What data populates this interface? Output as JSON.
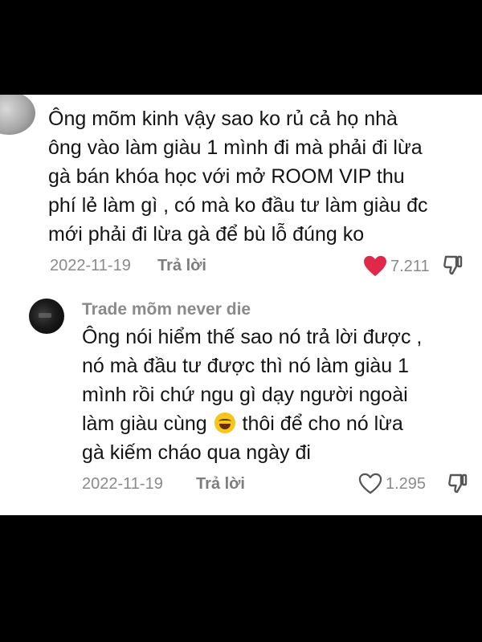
{
  "comment1": {
    "author_fragment": "",
    "text": "Ông mõm kinh vậy sao ko rủ cả họ nhà\nông vào làm giàu 1 mình đi mà phải đi lừa\ngà bán khóa học với mở ROOM VIP thu\nphí lẻ làm gì , có mà ko đầu tư làm giàu đc\nmới phải đi lừa gà để bù lỗ đúng ko",
    "date": "2022-11-19",
    "reply_label": "Trả lời",
    "likes": "7.211",
    "liked": true
  },
  "comment2": {
    "author": "Trade mõm never die",
    "text_before_emoji": "Ông nói hiểm thế sao nó trả lời được ,\nnó mà đầu tư được thì nó làm giàu 1\nmình rồi chứ ngu gì dạy người ngoài\nlàm giàu cùng ",
    "text_after_emoji": " thôi để cho nó lừa\ngà kiếm cháo qua ngày đi",
    "emoji": "laughing-emoji",
    "date": "2022-11-19",
    "reply_label": "Trả lời",
    "likes": "1.295",
    "liked": false
  },
  "colors": {
    "heart_filled": "#e0294a",
    "text": "#141414",
    "meta": "#8a8a8a"
  }
}
